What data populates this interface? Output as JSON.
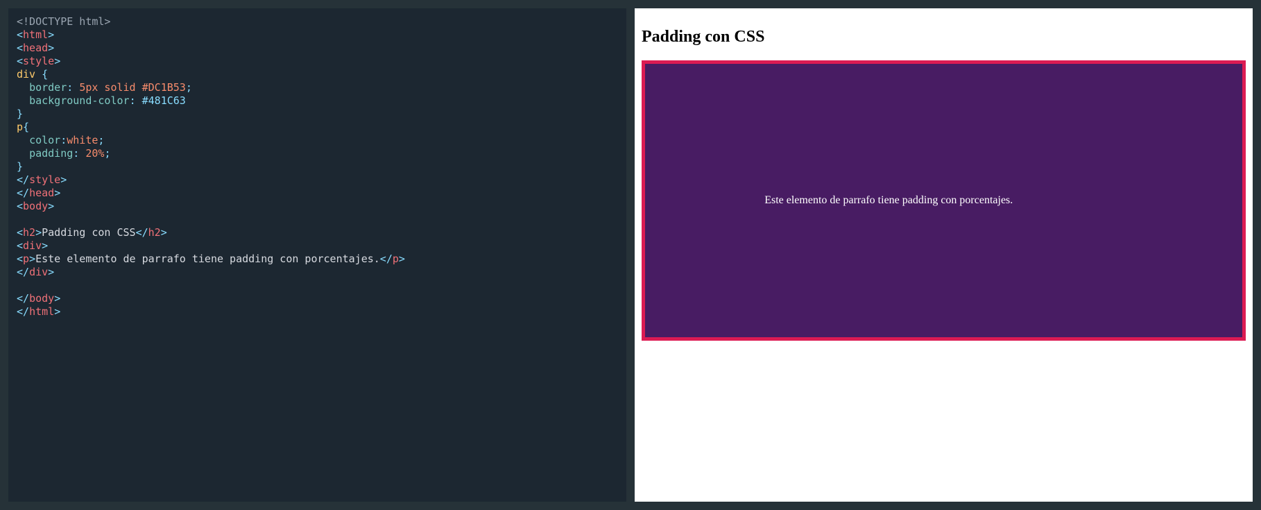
{
  "code": {
    "doctype": "<!DOCTYPE html>",
    "tags": {
      "html_open": "html",
      "html_close": "html",
      "head_open": "head",
      "head_close": "head",
      "style_open": "style",
      "style_close": "style",
      "body_open": "body",
      "body_close": "body",
      "h2_open": "h2",
      "h2_close": "h2",
      "div_open": "div",
      "div_close": "div",
      "p_open": "p",
      "p_close": "p"
    },
    "css": {
      "sel_div": "div ",
      "sel_p": "p",
      "prop_border": "border",
      "val_border": "5px solid #DC1B53",
      "prop_bg": "background-color",
      "val_bg": "#481C63",
      "prop_color": "color",
      "val_color": "white",
      "prop_padding": "padding",
      "val_padding": "20%"
    },
    "content": {
      "h2_text": "Padding con CSS",
      "p_text": "Este elemento de parrafo tiene padding con porcentajes."
    }
  },
  "preview": {
    "heading": "Padding con CSS",
    "paragraph": "Este elemento de parrafo tiene padding con porcentajes.",
    "colors": {
      "border": "#DC1B53",
      "bg": "#481C63",
      "text": "white"
    }
  }
}
